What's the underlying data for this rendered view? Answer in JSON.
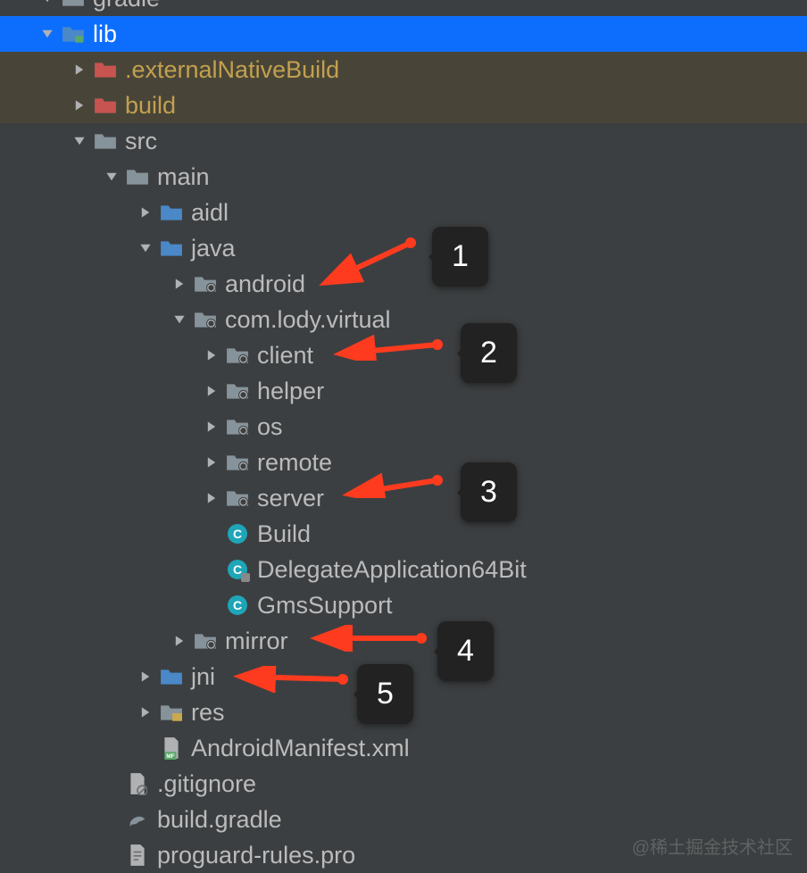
{
  "watermark": "@稀土掘金技术社区",
  "annotations": [
    "1",
    "2",
    "3",
    "4",
    "5"
  ],
  "rows": [
    {
      "id": "gradle",
      "indent": 44,
      "chev": "down",
      "icon": "folder-gray",
      "label": "gradle",
      "style": "cut-top"
    },
    {
      "id": "lib",
      "indent": 44,
      "chev": "down",
      "icon": "folder-module",
      "label": "lib",
      "style": "selected"
    },
    {
      "id": "externalNativeBuild",
      "indent": 80,
      "chev": "right",
      "icon": "folder-excl",
      "label": ".externalNativeBuild",
      "style": "excluded"
    },
    {
      "id": "build-dir",
      "indent": 80,
      "chev": "right",
      "icon": "folder-excl",
      "label": "build",
      "style": "excluded"
    },
    {
      "id": "src",
      "indent": 80,
      "chev": "down",
      "icon": "folder-gray",
      "label": "src"
    },
    {
      "id": "main",
      "indent": 116,
      "chev": "down",
      "icon": "folder-gray",
      "label": "main"
    },
    {
      "id": "aidl",
      "indent": 154,
      "chev": "right",
      "icon": "folder-src",
      "label": "aidl"
    },
    {
      "id": "java",
      "indent": 154,
      "chev": "down",
      "icon": "folder-src",
      "label": "java"
    },
    {
      "id": "android",
      "indent": 192,
      "chev": "right",
      "icon": "package",
      "label": "android"
    },
    {
      "id": "com-lody-virtual",
      "indent": 192,
      "chev": "down",
      "icon": "package",
      "label": "com.lody.virtual"
    },
    {
      "id": "client",
      "indent": 228,
      "chev": "right",
      "icon": "package",
      "label": "client"
    },
    {
      "id": "helper",
      "indent": 228,
      "chev": "right",
      "icon": "package",
      "label": "helper"
    },
    {
      "id": "os",
      "indent": 228,
      "chev": "right",
      "icon": "package",
      "label": "os"
    },
    {
      "id": "remote",
      "indent": 228,
      "chev": "right",
      "icon": "package",
      "label": "remote"
    },
    {
      "id": "server",
      "indent": 228,
      "chev": "right",
      "icon": "package",
      "label": "server"
    },
    {
      "id": "Build",
      "indent": 228,
      "chev": "none",
      "icon": "class",
      "label": "Build"
    },
    {
      "id": "DelegateApplication64Bit",
      "indent": 228,
      "chev": "none",
      "icon": "class-locked",
      "label": "DelegateApplication64Bit"
    },
    {
      "id": "GmsSupport",
      "indent": 228,
      "chev": "none",
      "icon": "class",
      "label": "GmsSupport"
    },
    {
      "id": "mirror",
      "indent": 192,
      "chev": "right",
      "icon": "package",
      "label": "mirror"
    },
    {
      "id": "jni",
      "indent": 154,
      "chev": "right",
      "icon": "folder-src",
      "label": "jni"
    },
    {
      "id": "res",
      "indent": 154,
      "chev": "right",
      "icon": "folder-res",
      "label": "res"
    },
    {
      "id": "AndroidManifest",
      "indent": 154,
      "chev": "none",
      "icon": "manifest",
      "label": "AndroidManifest.xml"
    },
    {
      "id": "gitignore",
      "indent": 116,
      "chev": "none",
      "icon": "file-ignore",
      "label": ".gitignore"
    },
    {
      "id": "build-gradle",
      "indent": 116,
      "chev": "none",
      "icon": "gradle",
      "label": "build.gradle"
    },
    {
      "id": "proguard",
      "indent": 116,
      "chev": "none",
      "icon": "file",
      "label": "proguard-rules.pro"
    }
  ]
}
